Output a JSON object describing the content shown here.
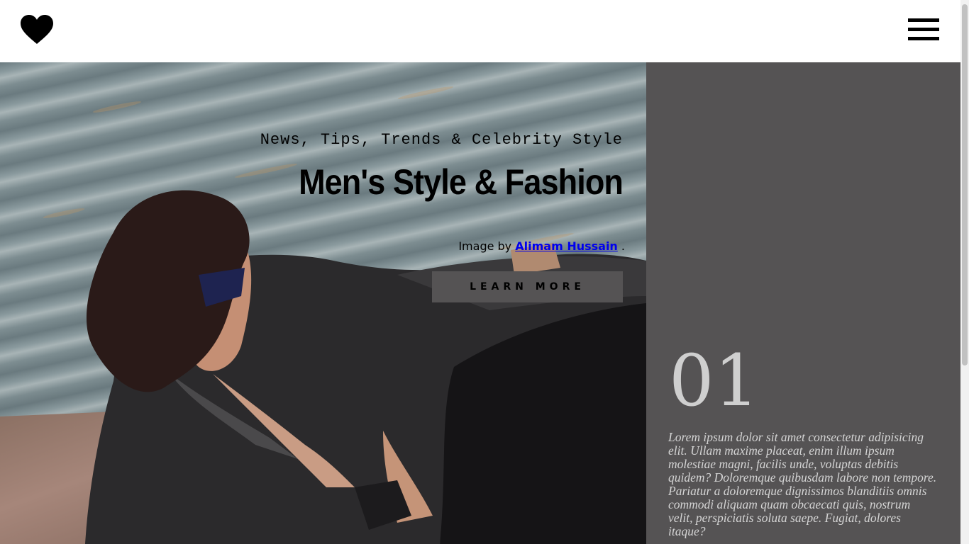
{
  "header": {
    "logo_icon": "heart-icon",
    "menu_icon": "hamburger-menu-icon"
  },
  "hero": {
    "tagline": "News, Tips, Trends & Celebrity Style",
    "title": "Men's Style & Fashion",
    "credit_prefix": "Image by",
    "credit_author": "Alimam Hussain",
    "credit_suffix": ".",
    "button_label": "LEARN MORE"
  },
  "side_panel": {
    "number": "01",
    "text": "Lorem ipsum dolor sit amet consectetur adipisicing elit. Ullam maxime placeat, enim illum ipsum molestiae magni, facilis unde, voluptas debitis quidem? Doloremque quibusdam labore non tempore. Pariatur a doloremque dignissimos blanditiis omnis commodi aliquam quam obcaecati quis, nostrum velit, perspiciatis soluta saepe. Fugiat, dolores itaque?"
  },
  "colors": {
    "panel": "#555354",
    "button": "#555354",
    "link": "#0000ee"
  }
}
